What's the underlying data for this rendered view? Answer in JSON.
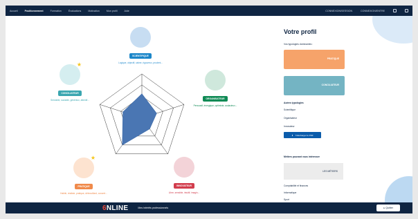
{
  "nav": {
    "items": [
      "Accueil",
      "Positionnement",
      "Formation",
      "Évaluations",
      "Motivation",
      "Mon profil",
      "Aide"
    ],
    "right": [
      "CONNEXION/SESSION",
      "CONNEXION/ENTRE"
    ]
  },
  "profiles": [
    {
      "name": "SCIENTIFIQUE",
      "desc": "Logique, objectif, calme, rigoureux, prudent...",
      "color": "#1b86c9",
      "text": "#2b8fcf"
    },
    {
      "name": "ORGANISATEUR",
      "desc": "Persuasif, énergique, optimiste, audacieux...",
      "color": "#0f8a55",
      "text": "#0f8a55"
    },
    {
      "name": "INNOVATEUR",
      "desc": "Libre, sensible, intuitif, imagin...",
      "color": "#d23d4d",
      "text": "#d23d4d"
    },
    {
      "name": "PRATIQUE",
      "desc": "Habile, réaliste, pratique, débrouillard, concret...",
      "color": "#f08a4b",
      "text": "#f08a4b"
    },
    {
      "name": "CONCILIATEUR",
      "desc": "Serviable, sociable, généreux, attentif...",
      "color": "#3aa6b0",
      "text": "#3aa6b0"
    }
  ],
  "radar": {
    "scores": [
      0.55,
      0.35,
      0.3,
      0.75,
      0.45
    ]
  },
  "panel": {
    "title": "Votre profil",
    "dominant_heading": "Vos typologies dominantes :",
    "dominant": [
      "PRATIQUE",
      "CONCILIATEUR"
    ],
    "other_heading": "Autres typologies",
    "others": [
      "Scientifique",
      "Organisateur",
      "Innovateur"
    ],
    "download": "Télécharger le PDF",
    "jobs_heading": "Métiers pouvant vous intéresser",
    "jobs_card": "LES MÉTIERS",
    "sectors": [
      "Comptabilité et finances",
      "Informatique",
      "Sport"
    ]
  },
  "footer": {
    "logo_six": "6",
    "logo_rest": "NLINE",
    "title": "Mes intérêts professionnels",
    "quit": "Quitter"
  }
}
